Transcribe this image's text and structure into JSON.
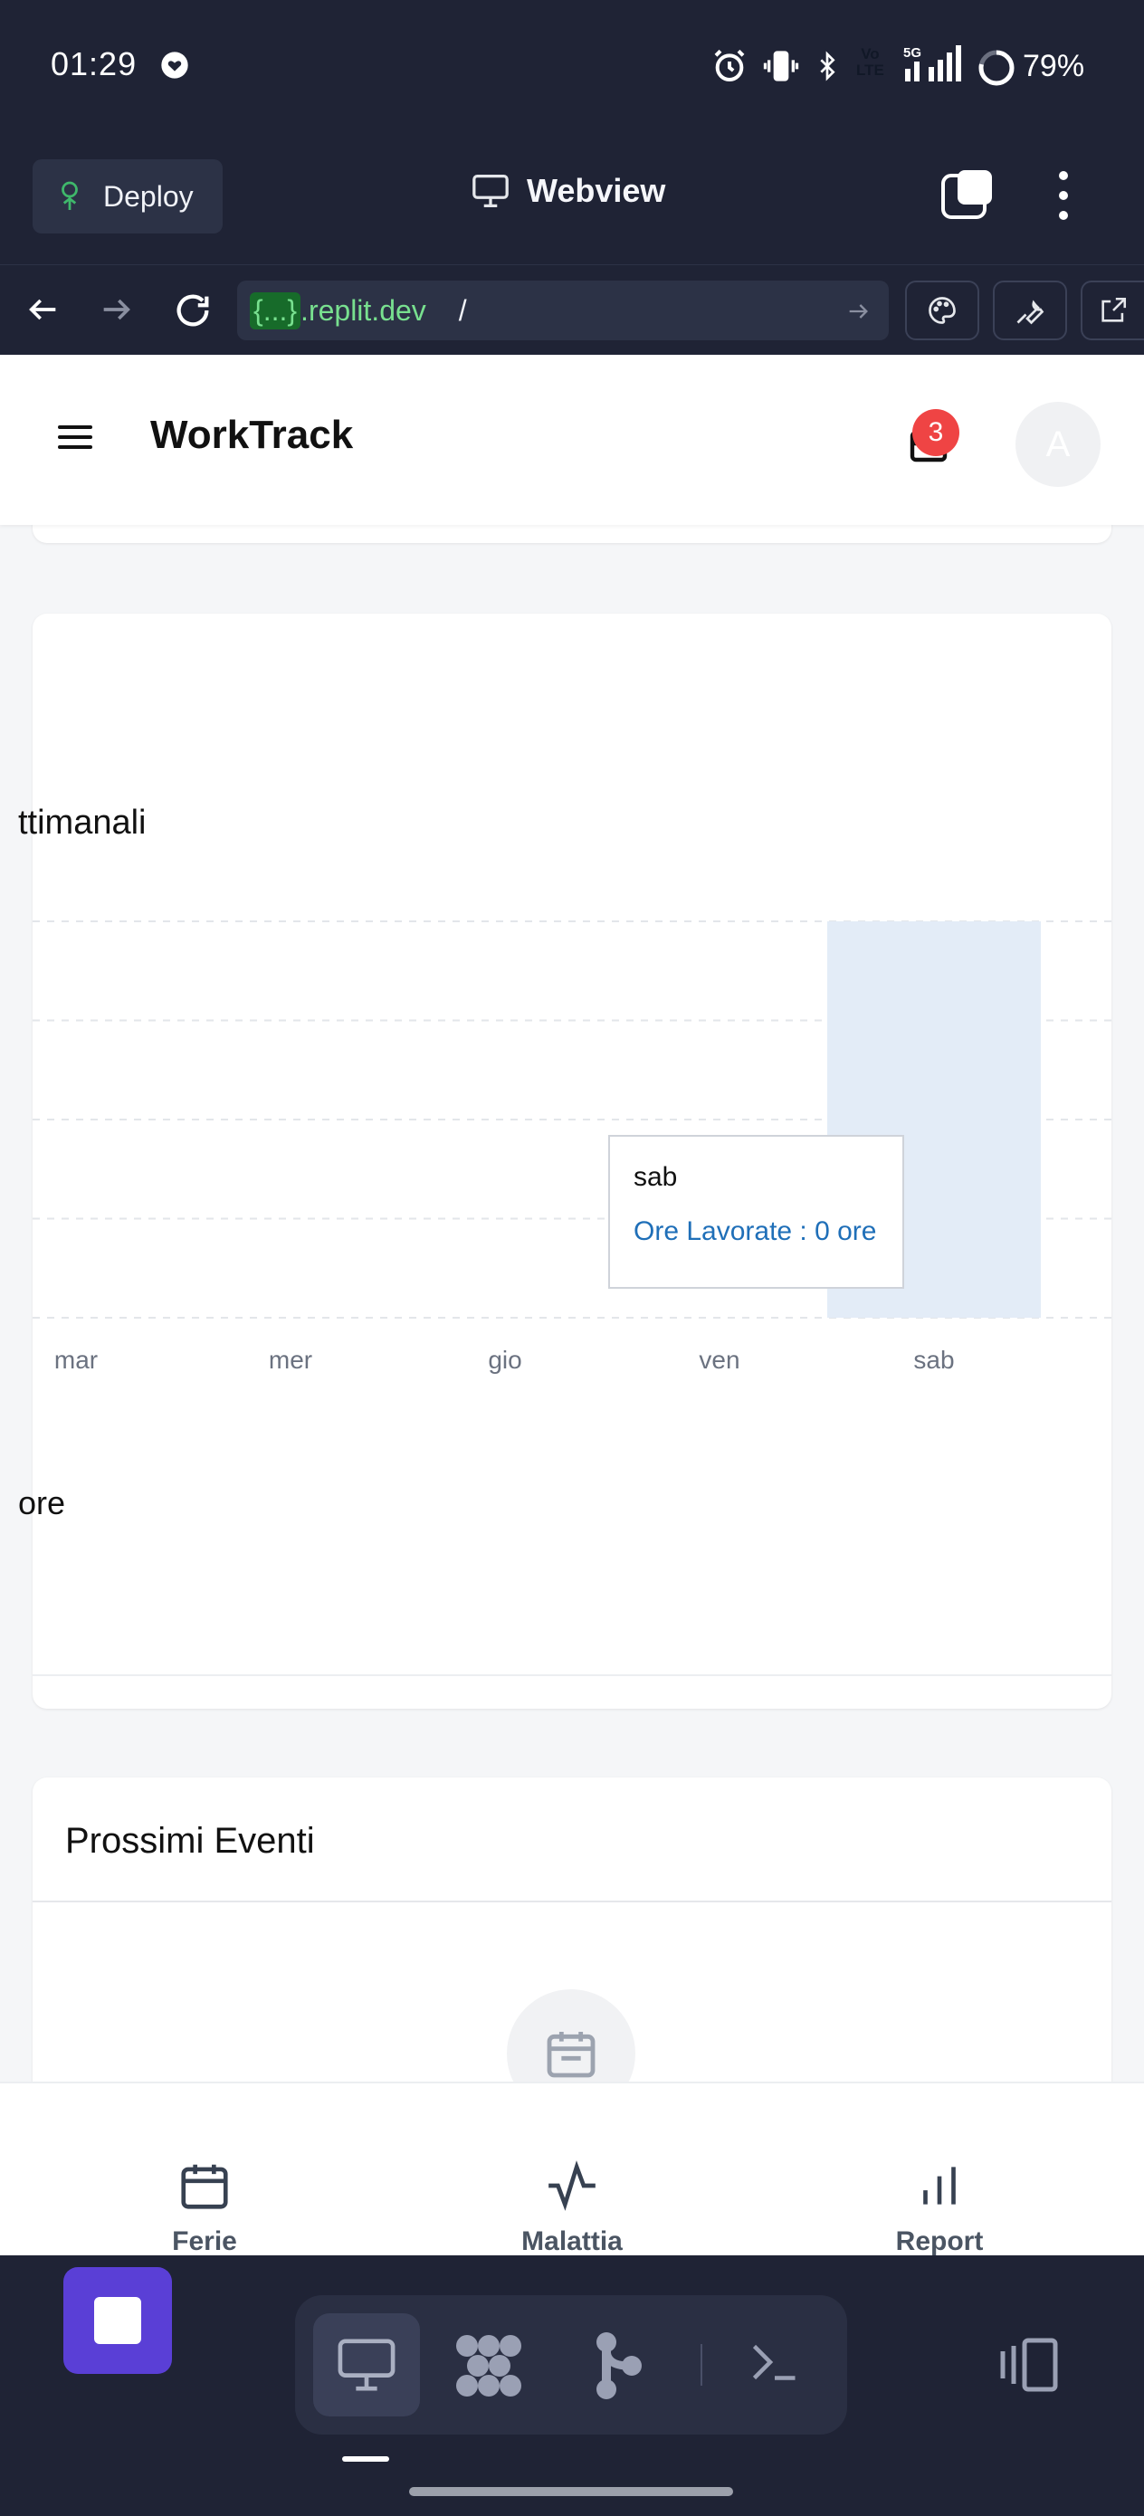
{
  "status_bar": {
    "time": "01:29",
    "network": "5G",
    "volte_top": "Vo",
    "volte_bottom": "LTE",
    "battery": "79%"
  },
  "replit_top": {
    "deploy_label": "Deploy",
    "webview_label": "Webview"
  },
  "url_bar": {
    "host_code": "{...}",
    "host_domain": ".replit.dev",
    "path": "/"
  },
  "app": {
    "title": "WorkTrack",
    "notification_count": "3",
    "avatar_initial": "A"
  },
  "chart_card": {
    "title_partial": "ttimanali",
    "footer_partial": "ore"
  },
  "chart_data": {
    "type": "bar",
    "categories": [
      "mar",
      "mer",
      "gio",
      "ven",
      "sab"
    ],
    "series": [
      {
        "name": "Ore Lavorate",
        "values": [
          0,
          0,
          0,
          0,
          0
        ]
      }
    ],
    "highlighted_category": "sab",
    "grid": true,
    "tooltip": {
      "label": "sab",
      "text": "Ore Lavorate : 0 ore"
    }
  },
  "events_card": {
    "title": "Prossimi Eventi"
  },
  "bottom_nav": {
    "items": [
      {
        "label": "Ferie",
        "icon": "calendar-icon"
      },
      {
        "label": "Malattia",
        "icon": "activity-icon"
      },
      {
        "label": "Report",
        "icon": "bar-chart-icon"
      }
    ]
  },
  "colors": {
    "chrome_bg": "#1f2335",
    "accent": "#5a3fd6",
    "badge": "#ef4444",
    "link_blue": "#1f6fb8",
    "url_green": "#78e08f"
  }
}
